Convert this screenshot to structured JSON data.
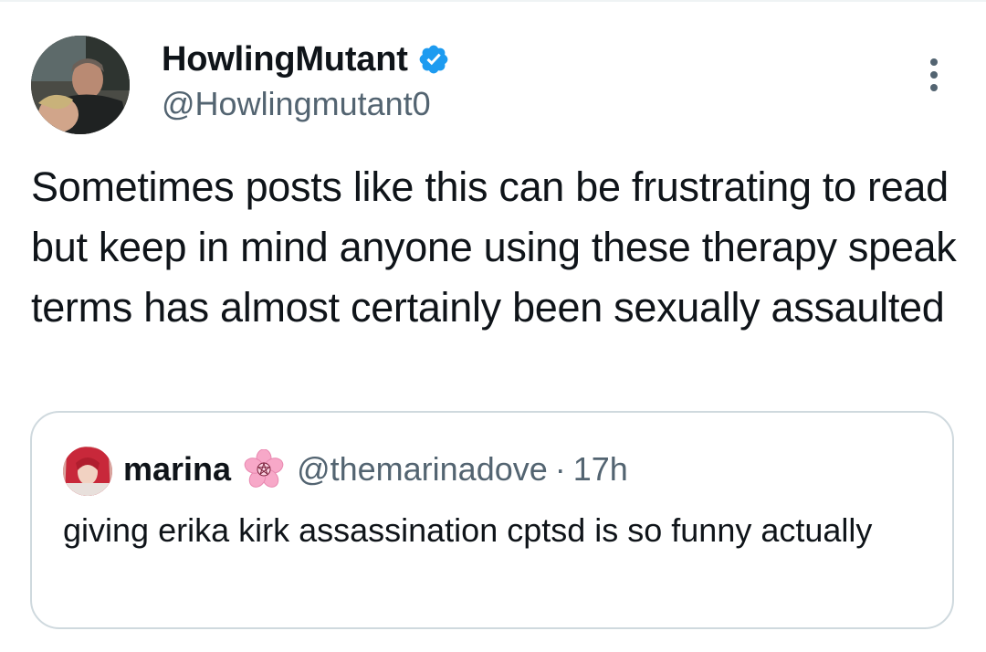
{
  "tweet": {
    "author": {
      "display_name": "HowlingMutant",
      "handle": "@Howlingmutant0",
      "verified": true
    },
    "text": "Sometimes posts like this can be frustrating to read but keep in mind anyone using these therapy speak terms has almost certainly been sexually assaulted",
    "more_icon": "more-dots-icon"
  },
  "quote": {
    "author": {
      "display_name": "marina",
      "emoji": "cherry-blossom-pentagram-icon",
      "handle": "@themarinadove"
    },
    "separator": "·",
    "time": "17h",
    "text": "giving erika kirk assassination cptsd is so funny actually"
  },
  "colors": {
    "text_primary": "#0f1419",
    "text_secondary": "#536471",
    "verified_blue": "#1d9bf0",
    "border": "#cfd9de"
  }
}
